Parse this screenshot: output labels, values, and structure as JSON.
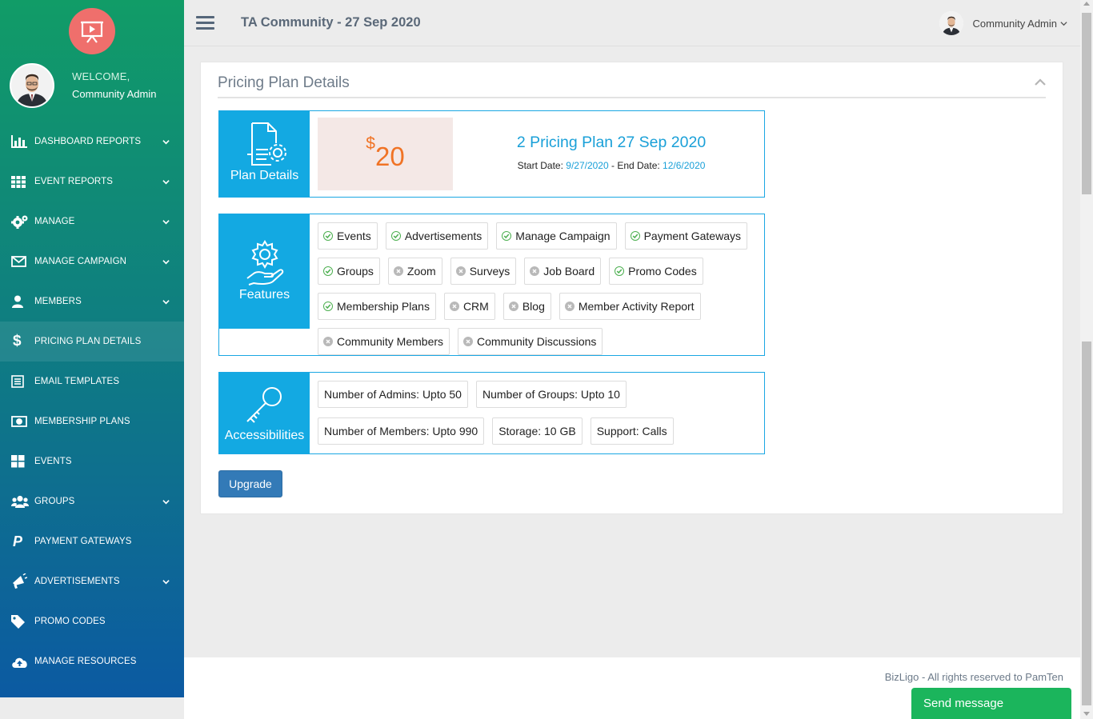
{
  "sidebar": {
    "welcome_label": "WELCOME,",
    "user_name": "Community Admin",
    "items": [
      {
        "label": "DASHBOARD REPORTS",
        "icon": "bar-chart-icon",
        "has_chevron": true
      },
      {
        "label": "EVENT REPORTS",
        "icon": "grid-icon",
        "has_chevron": true
      },
      {
        "label": "MANAGE",
        "icon": "gears-icon",
        "has_chevron": true
      },
      {
        "label": "MANAGE CAMPAIGN",
        "icon": "envelope-icon",
        "has_chevron": true
      },
      {
        "label": "MEMBERS",
        "icon": "user-icon",
        "has_chevron": true
      },
      {
        "label": "PRICING PLAN DETAILS",
        "icon": "dollar-icon",
        "has_chevron": false,
        "active": true
      },
      {
        "label": "EMAIL TEMPLATES",
        "icon": "template-icon",
        "has_chevron": false
      },
      {
        "label": "MEMBERSHIP PLANS",
        "icon": "money-icon",
        "has_chevron": false
      },
      {
        "label": "EVENTS",
        "icon": "tiles-icon",
        "has_chevron": false
      },
      {
        "label": "GROUPS",
        "icon": "users-icon",
        "has_chevron": true
      },
      {
        "label": "PAYMENT GATEWAYS",
        "icon": "paypal-icon",
        "has_chevron": false
      },
      {
        "label": "ADVERTISEMENTS",
        "icon": "bullhorn-icon",
        "has_chevron": true
      },
      {
        "label": "PROMO CODES",
        "icon": "tag-icon",
        "has_chevron": false
      },
      {
        "label": "MANAGE RESOURCES",
        "icon": "cloud-upload-icon",
        "has_chevron": false
      }
    ]
  },
  "topbar": {
    "title": "TA Community - 27 Sep 2020",
    "user_name": "Community Admin"
  },
  "panel": {
    "title": "Pricing Plan Details"
  },
  "plan": {
    "side_label": "Plan Details",
    "currency": "$",
    "price": "20",
    "name": "2 Pricing Plan 27 Sep 2020",
    "start_label": "Start Date:",
    "start_date": "9/27/2020",
    "end_label": "- End Date:",
    "end_date": "12/6/2020"
  },
  "features": {
    "side_label": "Features",
    "items": [
      {
        "label": "Events",
        "enabled": true
      },
      {
        "label": "Advertisements",
        "enabled": true
      },
      {
        "label": "Manage Campaign",
        "enabled": true
      },
      {
        "label": "Payment Gateways",
        "enabled": true
      },
      {
        "label": "Groups",
        "enabled": true
      },
      {
        "label": "Zoom",
        "enabled": false
      },
      {
        "label": "Surveys",
        "enabled": false
      },
      {
        "label": "Job Board",
        "enabled": false
      },
      {
        "label": "Promo Codes",
        "enabled": true
      },
      {
        "label": "Membership Plans",
        "enabled": true
      },
      {
        "label": "CRM",
        "enabled": false
      },
      {
        "label": "Blog",
        "enabled": false
      },
      {
        "label": "Member Activity Report",
        "enabled": false
      },
      {
        "label": "Community Members",
        "enabled": false
      },
      {
        "label": "Community Discussions",
        "enabled": false
      }
    ]
  },
  "accessibilities": {
    "side_label": "Accessibilities",
    "items": [
      {
        "label": "Number of Admins: Upto 50"
      },
      {
        "label": "Number of Groups: Upto 10"
      },
      {
        "label": "Number of Members: Upto 990"
      },
      {
        "label": "Storage: 10 GB"
      },
      {
        "label": "Support: Calls"
      }
    ]
  },
  "upgrade_label": "Upgrade",
  "footer": {
    "text": "BizLigo - All rights reserved to PamTen"
  },
  "send_message_label": "Send message",
  "colors": {
    "accent": "#13a9e2",
    "price": "#f07325",
    "enabled": "#4caf50",
    "disabled": "#b9b9b9",
    "button": "#337ab7",
    "send": "#1bb55c"
  }
}
